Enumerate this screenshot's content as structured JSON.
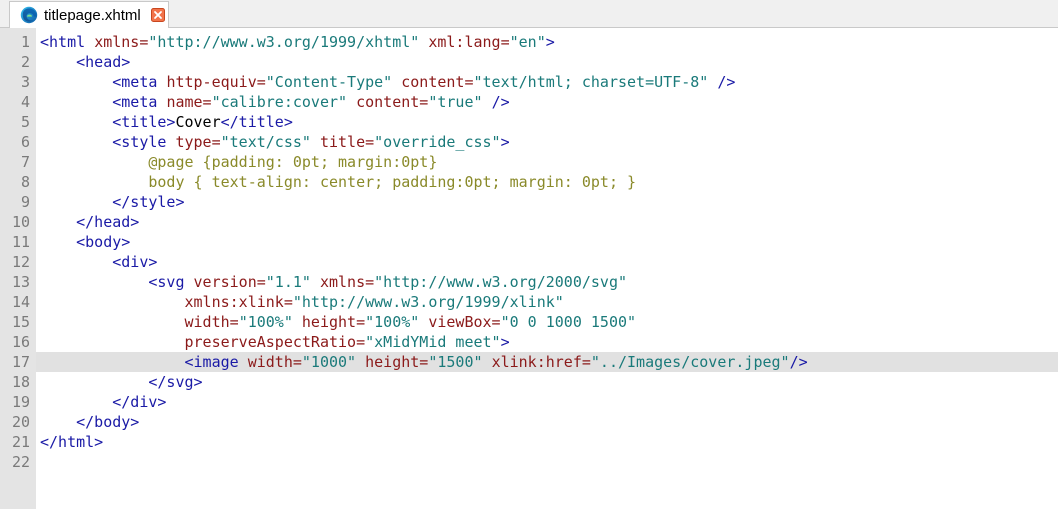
{
  "tab": {
    "filename": "titlepage.xhtml",
    "icon": "edge-browser-icon",
    "close_icon": "close-icon"
  },
  "colors": {
    "tag": "#1a1aa6",
    "attribute": "#8b1a1a",
    "value": "#1a7a7a",
    "css": "#8a8a2a",
    "gutter": "#e4e4e4",
    "current_line": "#e1e1e1"
  },
  "editor": {
    "current_line": 17,
    "lines": [
      {
        "n": "1",
        "tokens": [
          [
            "tag",
            "<html "
          ],
          [
            "attr",
            "xmlns="
          ],
          [
            "val",
            "\"http://www.w3.org/1999/xhtml\""
          ],
          [
            "text",
            " "
          ],
          [
            "attr",
            "xml:lang="
          ],
          [
            "val",
            "\"en\""
          ],
          [
            "tag",
            ">"
          ]
        ]
      },
      {
        "n": "2",
        "tokens": [
          [
            "text",
            "    "
          ],
          [
            "tag",
            "<head>"
          ]
        ]
      },
      {
        "n": "3",
        "tokens": [
          [
            "text",
            "        "
          ],
          [
            "tag",
            "<meta "
          ],
          [
            "attr",
            "http-equiv="
          ],
          [
            "val",
            "\"Content-Type\""
          ],
          [
            "text",
            " "
          ],
          [
            "attr",
            "content="
          ],
          [
            "val",
            "\"text/html; charset=UTF-8\""
          ],
          [
            "text",
            " "
          ],
          [
            "tag",
            "/>"
          ]
        ]
      },
      {
        "n": "4",
        "tokens": [
          [
            "text",
            "        "
          ],
          [
            "tag",
            "<meta "
          ],
          [
            "attr",
            "name="
          ],
          [
            "val",
            "\"calibre:cover\""
          ],
          [
            "text",
            " "
          ],
          [
            "attr",
            "content="
          ],
          [
            "val",
            "\"true\""
          ],
          [
            "text",
            " "
          ],
          [
            "tag",
            "/>"
          ]
        ]
      },
      {
        "n": "5",
        "tokens": [
          [
            "text",
            "        "
          ],
          [
            "tag",
            "<title>"
          ],
          [
            "text",
            "Cover"
          ],
          [
            "tag",
            "</title>"
          ]
        ]
      },
      {
        "n": "6",
        "tokens": [
          [
            "text",
            "        "
          ],
          [
            "tag",
            "<style "
          ],
          [
            "attr",
            "type="
          ],
          [
            "val",
            "\"text/css\""
          ],
          [
            "text",
            " "
          ],
          [
            "attr",
            "title="
          ],
          [
            "val",
            "\"override_css\""
          ],
          [
            "tag",
            ">"
          ]
        ]
      },
      {
        "n": "7",
        "tokens": [
          [
            "text",
            "            "
          ],
          [
            "css",
            "@page {padding: 0pt; margin:0pt}"
          ]
        ]
      },
      {
        "n": "8",
        "tokens": [
          [
            "text",
            "            "
          ],
          [
            "css",
            "body { text-align: center; padding:0pt; margin: 0pt; }"
          ]
        ]
      },
      {
        "n": "9",
        "tokens": [
          [
            "text",
            "        "
          ],
          [
            "tag",
            "</style>"
          ]
        ]
      },
      {
        "n": "10",
        "tokens": [
          [
            "text",
            "    "
          ],
          [
            "tag",
            "</head>"
          ]
        ]
      },
      {
        "n": "11",
        "tokens": [
          [
            "text",
            "    "
          ],
          [
            "tag",
            "<body>"
          ]
        ]
      },
      {
        "n": "12",
        "tokens": [
          [
            "text",
            "        "
          ],
          [
            "tag",
            "<div>"
          ]
        ]
      },
      {
        "n": "13",
        "tokens": [
          [
            "text",
            "            "
          ],
          [
            "tag",
            "<svg "
          ],
          [
            "attr",
            "version="
          ],
          [
            "val",
            "\"1.1\""
          ],
          [
            "text",
            " "
          ],
          [
            "attr",
            "xmlns="
          ],
          [
            "val",
            "\"http://www.w3.org/2000/svg\""
          ]
        ]
      },
      {
        "n": "14",
        "tokens": [
          [
            "text",
            "                "
          ],
          [
            "attr",
            "xmlns:xlink="
          ],
          [
            "val",
            "\"http://www.w3.org/1999/xlink\""
          ]
        ]
      },
      {
        "n": "15",
        "tokens": [
          [
            "text",
            "                "
          ],
          [
            "attr",
            "width="
          ],
          [
            "val",
            "\"100%\""
          ],
          [
            "text",
            " "
          ],
          [
            "attr",
            "height="
          ],
          [
            "val",
            "\"100%\""
          ],
          [
            "text",
            " "
          ],
          [
            "attr",
            "viewBox="
          ],
          [
            "val",
            "\"0 0 1000 1500\""
          ]
        ]
      },
      {
        "n": "16",
        "tokens": [
          [
            "text",
            "                "
          ],
          [
            "attr",
            "preserveAspectRatio="
          ],
          [
            "val",
            "\"xMidYMid meet\""
          ],
          [
            "tag",
            ">"
          ]
        ]
      },
      {
        "n": "17",
        "tokens": [
          [
            "text",
            "                "
          ],
          [
            "tag",
            "<image "
          ],
          [
            "attr",
            "width="
          ],
          [
            "val",
            "\"1000\""
          ],
          [
            "text",
            " "
          ],
          [
            "attr",
            "height="
          ],
          [
            "val",
            "\"1500\""
          ],
          [
            "text",
            " "
          ],
          [
            "attr",
            "xlink:href="
          ],
          [
            "val",
            "\"../Images/cover.jpeg\""
          ],
          [
            "tag",
            "/>"
          ]
        ]
      },
      {
        "n": "18",
        "tokens": [
          [
            "text",
            "            "
          ],
          [
            "tag",
            "</svg>"
          ]
        ]
      },
      {
        "n": "19",
        "tokens": [
          [
            "text",
            "        "
          ],
          [
            "tag",
            "</div>"
          ]
        ]
      },
      {
        "n": "20",
        "tokens": [
          [
            "text",
            "    "
          ],
          [
            "tag",
            "</body>"
          ]
        ]
      },
      {
        "n": "21",
        "tokens": [
          [
            "tag",
            "</html>"
          ]
        ]
      },
      {
        "n": "22",
        "tokens": []
      }
    ]
  }
}
